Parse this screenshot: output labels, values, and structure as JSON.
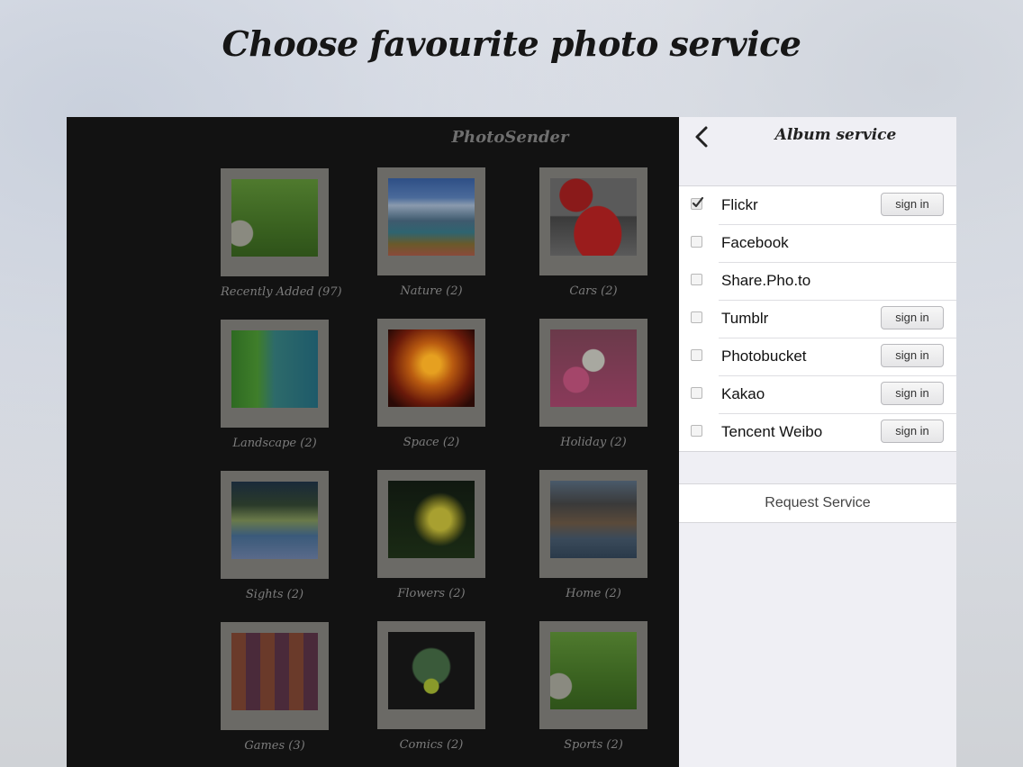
{
  "headline": "Choose favourite photo service",
  "app": {
    "title": "PhotoSender",
    "albums": [
      {
        "label": "Recently Added (97)"
      },
      {
        "label": "Nature (2)"
      },
      {
        "label": "Cars (2)"
      },
      {
        "label": "Landscape (2)"
      },
      {
        "label": "Space (2)"
      },
      {
        "label": "Holiday (2)"
      },
      {
        "label": "Sights (2)"
      },
      {
        "label": "Flowers (2)"
      },
      {
        "label": "Home (2)"
      },
      {
        "label": "Games (3)"
      },
      {
        "label": "Comics (2)"
      },
      {
        "label": "Sports (2)"
      }
    ]
  },
  "panel": {
    "back_icon": "chevron-left-icon",
    "title": "Album service",
    "services": [
      {
        "name": "Flickr",
        "checked": true,
        "signin": "sign in"
      },
      {
        "name": "Facebook",
        "checked": false,
        "signin": null
      },
      {
        "name": "Share.Pho.to",
        "checked": false,
        "signin": null
      },
      {
        "name": "Tumblr",
        "checked": false,
        "signin": "sign in"
      },
      {
        "name": "Photobucket",
        "checked": false,
        "signin": "sign in"
      },
      {
        "name": "Kakao",
        "checked": false,
        "signin": "sign in"
      },
      {
        "name": "Tencent Weibo",
        "checked": false,
        "signin": "sign in"
      }
    ],
    "request_label": "Request Service"
  }
}
